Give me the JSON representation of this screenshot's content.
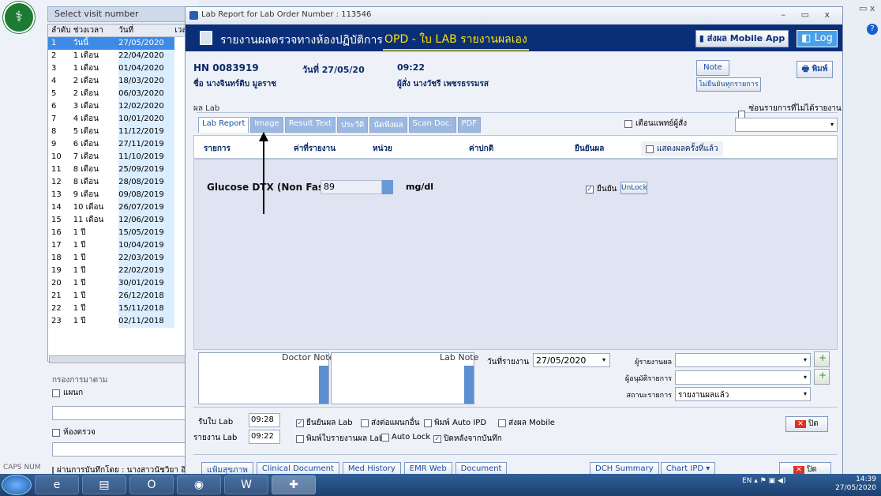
{
  "left_panel": {
    "visit_header": "Select visit number",
    "columns": [
      "ลำดับ",
      "ช่วงเวลา",
      "วันที่",
      "เวล"
    ],
    "rows": [
      [
        "1",
        "วันนี้",
        "27/05/2020"
      ],
      [
        "2",
        "1 เดือน",
        "22/04/2020"
      ],
      [
        "3",
        "1 เดือน",
        "01/04/2020"
      ],
      [
        "4",
        "2 เดือน",
        "18/03/2020"
      ],
      [
        "5",
        "2 เดือน",
        "06/03/2020"
      ],
      [
        "6",
        "3 เดือน",
        "12/02/2020"
      ],
      [
        "7",
        "4 เดือน",
        "10/01/2020"
      ],
      [
        "8",
        "5 เดือน",
        "11/12/2019"
      ],
      [
        "9",
        "6 เดือน",
        "27/11/2019"
      ],
      [
        "10",
        "7 เดือน",
        "11/10/2019"
      ],
      [
        "11",
        "8 เดือน",
        "25/09/2019"
      ],
      [
        "12",
        "8 เดือน",
        "28/08/2019"
      ],
      [
        "13",
        "9 เดือน",
        "09/08/2019"
      ],
      [
        "14",
        "10 เดือน",
        "26/07/2019"
      ],
      [
        "15",
        "11 เดือน",
        "12/06/2019"
      ],
      [
        "16",
        "1 ปี",
        "15/05/2019"
      ],
      [
        "17",
        "1 ปี",
        "10/04/2019"
      ],
      [
        "18",
        "1 ปี",
        "22/03/2019"
      ],
      [
        "19",
        "1 ปี",
        "22/02/2019"
      ],
      [
        "20",
        "1 ปี",
        "30/01/2019"
      ],
      [
        "21",
        "1 ปี",
        "26/12/2018"
      ],
      [
        "22",
        "1 ปี",
        "15/11/2018"
      ],
      [
        "23",
        "1 ปี",
        "02/11/2018"
      ]
    ],
    "filter_label": "กรองการมาตาม",
    "dept_label": "แผนก",
    "room_label": "ห้องตรวจ",
    "recorder_label": "ผ่านการบันทึกโดย : นางสาวนัชวิยา อินทร",
    "status_caps": "CAPS NUM"
  },
  "window": {
    "title": "Lab Report for Lab Order Number : 113546",
    "controls": "– ▭ x",
    "banner_title": "รายงานผลตรวจทางห้องปฏิบัติการ",
    "banner_opd": "OPD - ใบ LAB รายงานผลเอง",
    "mobile_btn": "ส่งผล Mobile App",
    "log_btn": "Log"
  },
  "patient": {
    "hn": "HN 0083919",
    "date": "วันที่ 27/05/20",
    "time": "09:22",
    "name": "ชื่อ นางจินทร์ติบ มูลราช",
    "ordered_by": "ผู้สั่ง นางวัชรี เพชรธรรมรส",
    "note_btn": "Note",
    "no_confirm_btn": "ไม่ยืนยันทุกรายการ",
    "print_btn": "พิมพ์"
  },
  "lab": {
    "section_label": "ผล Lab",
    "hide_unreported": "ซ่อนรายการที่ไม่ได้รายงานผล",
    "tabs": [
      "Lab Report",
      "Image",
      "Result Text",
      "ประวัติ",
      "นัดฟังผล",
      "Scan Doc.",
      "PDF"
    ],
    "notify_doctor": "เตือนแพทย์ผู้สั่ง",
    "headers": [
      "รายการ",
      "ค่าที่รายงาน",
      "หน่วย",
      "ค่าปกติ",
      "ยืนยันผล"
    ],
    "show_reported": "แสดงผลครั้งที่แล้ว",
    "test": {
      "name": "Glucose DTX (Non Fasting",
      "value": "89",
      "unit": "mg/dl",
      "confirm": "ยืนยัน",
      "unlock": "UnLock"
    }
  },
  "notes": {
    "doctor_note": "Doctor Note",
    "lab_note": "Lab Note",
    "report_date_label": "วันที่รายงาน",
    "report_date": "27/05/2020",
    "reporter_label": "ผู้รายงานผล",
    "approver_label": "ผู้อนุมัติรายการ",
    "status_label": "สถานะรายการ",
    "status_value": "รายงานผลแล้ว"
  },
  "footer": {
    "recv_label": "รับใบ Lab",
    "recv_time": "09:28",
    "report_label": "รายงาน Lab",
    "report_time": "09:22",
    "opt_confirm": "ยืนยันผล Lab",
    "opt_send_other": "ส่งต่อแผนกอื่น",
    "opt_auto_ipd": "พิมพ์ Auto IPD",
    "opt_mobile": "ส่งผล Mobile",
    "opt_print_report": "พิมพ์ใบรายงานผล Lab",
    "opt_auto_lock": "Auto Lock",
    "opt_close_after": "ปิดหลังจากบันทึก",
    "close_btn": "ปิด",
    "bottom_buttons": [
      "แฟ้มสุขภาพ",
      "Clinical Document",
      "Med History",
      "EMR Web",
      "Document"
    ],
    "dch_summary": "DCH Summary",
    "chart_ipd": "Chart IPD",
    "close_btn2": "ปิด"
  },
  "taskbar": {
    "tray": "EN",
    "time": "14:39",
    "date": "27/05/2020"
  }
}
